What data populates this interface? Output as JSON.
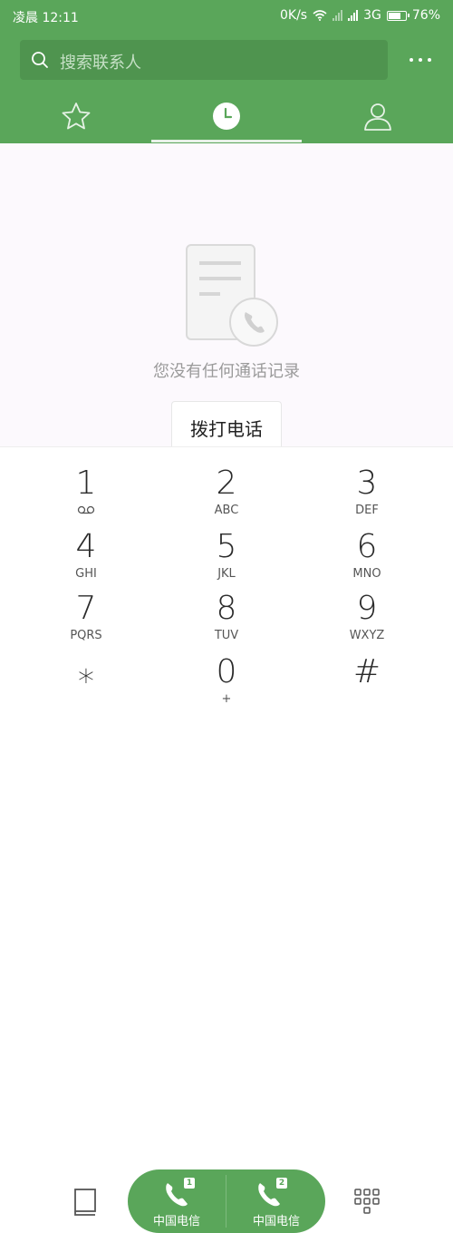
{
  "status_bar": {
    "time": "凌晨 12:11",
    "speed": "0K/s",
    "network": "3G",
    "battery": "76%",
    "battery_level": 0.76
  },
  "search": {
    "placeholder": "搜索联系人"
  },
  "tabs": [
    {
      "icon": "star-icon"
    },
    {
      "icon": "clock-icon",
      "selected": true
    },
    {
      "icon": "person-icon"
    }
  ],
  "empty_state": {
    "message": "您没有任何通话记录",
    "button_label": "拨打电话"
  },
  "dialpad": {
    "keys": [
      {
        "digit": "1",
        "letters": ""
      },
      {
        "digit": "2",
        "letters": "ABC"
      },
      {
        "digit": "3",
        "letters": "DEF"
      },
      {
        "digit": "4",
        "letters": "GHI"
      },
      {
        "digit": "5",
        "letters": "JKL"
      },
      {
        "digit": "6",
        "letters": "MNO"
      },
      {
        "digit": "7",
        "letters": "PQRS"
      },
      {
        "digit": "8",
        "letters": "TUV"
      },
      {
        "digit": "9",
        "letters": "WXYZ"
      },
      {
        "digit": "⁎",
        "letters": ""
      },
      {
        "digit": "0",
        "letters": "+"
      },
      {
        "digit": "#",
        "letters": ""
      }
    ]
  },
  "bottom_bar": {
    "sim1": {
      "badge": "1",
      "label": "中国电信"
    },
    "sim2": {
      "badge": "2",
      "label": "中国电信"
    }
  },
  "colors": {
    "accent": "#5aa65a",
    "accent_dark": "#4f944f"
  }
}
